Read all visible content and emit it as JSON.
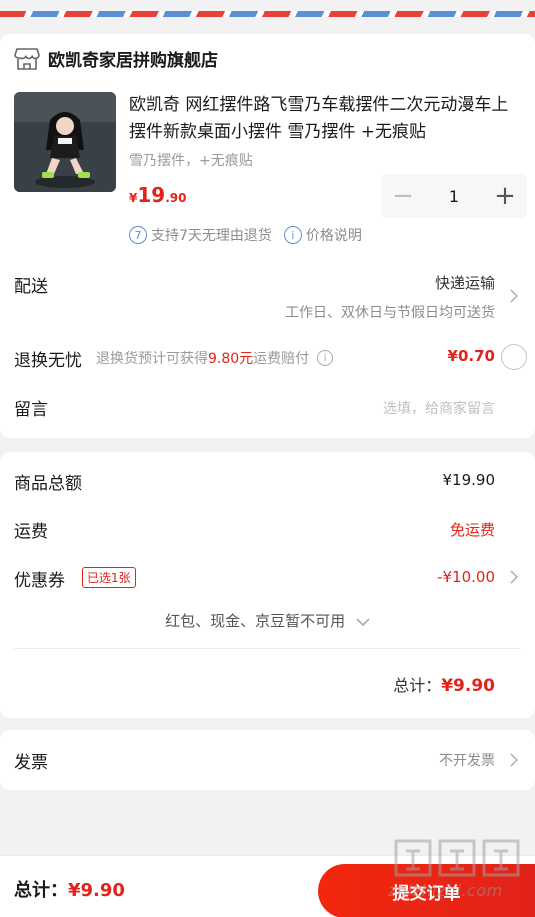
{
  "shop": {
    "name": "欧凯奇家居拼购旗舰店",
    "icon": "store-icon"
  },
  "product": {
    "title": "欧凯奇 网红摆件路飞雪乃车载摆件二次元动漫车上摆件新款桌面小摆件 雪乃摆件 +无痕贴",
    "spec": "雪乃摆件，+无痕贴",
    "price_currency": "¥",
    "price_int": "19",
    "price_dec": ".90",
    "quantity": "1",
    "minus_label": "−",
    "plus_label": "+",
    "policy_badge": "7",
    "policy_text": "支持7天无理由退货",
    "price_info_badge": "i",
    "price_info_text": "价格说明"
  },
  "delivery": {
    "label": "配送",
    "value": "快递运输",
    "sub": "工作日、双休日与节假日均可送货"
  },
  "return_insurance": {
    "label": "退换无忧",
    "note_prefix": "退换货预计可获得",
    "note_amount": "9.80元",
    "note_suffix": "运费赔付",
    "info_badge": "i",
    "price": "¥0.70"
  },
  "message": {
    "label": "留言",
    "placeholder": "选填，给商家留言"
  },
  "summary": {
    "goods_label": "商品总额",
    "goods_value": "¥19.90",
    "shipping_label": "运费",
    "shipping_value": "免运费",
    "coupon_label": "优惠券",
    "coupon_badge": "已选1张",
    "coupon_value": "-¥10.00",
    "unavailable": "红包、现金、京豆暂不可用",
    "total_label": "总计：",
    "total_value": "¥9.90"
  },
  "invoice": {
    "label": "发票",
    "value": "不开发票"
  },
  "bottom": {
    "total_label": "总计：",
    "total_value": "¥9.90",
    "submit_label": "提交订单"
  },
  "watermark": {
    "text": "zhizhizhi.com"
  },
  "colors": {
    "accent": "#e2231a",
    "blue": "#5b8fd6"
  }
}
